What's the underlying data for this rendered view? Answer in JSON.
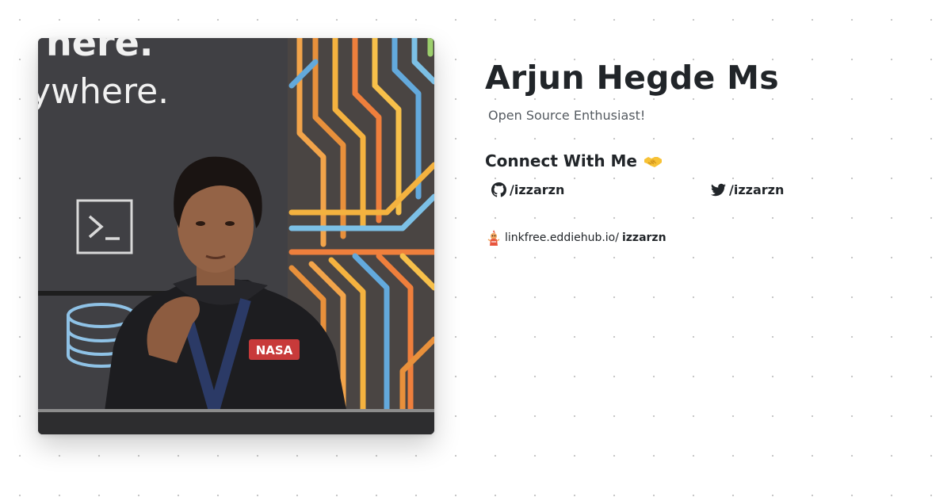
{
  "profile": {
    "name": "Arjun Hegde Ms",
    "bio": "Open Source Enthusiast!",
    "photo_alt": "Profile photo"
  },
  "connect": {
    "heading": "Connect With Me",
    "emoji": "handshake-emoji",
    "links": [
      {
        "icon": "github-icon",
        "label": "/izzarzn"
      },
      {
        "icon": "twitter-icon",
        "label": "/izzarzn"
      }
    ]
  },
  "linkfree": {
    "icon": "eddiehub-logo-icon",
    "prefix": "linkfree.eddiehub.io/",
    "username": "izzarzn"
  },
  "photo_text": {
    "line1": "here.",
    "line2": "ywhere.",
    "shirt": "NASA"
  },
  "colors": {
    "heading": "#212529",
    "bio": "#555b61",
    "background": "#ffffff",
    "dots": "#c4c4c4",
    "accent_orange": "#f08a3c",
    "accent_blue": "#5fa7d9"
  }
}
